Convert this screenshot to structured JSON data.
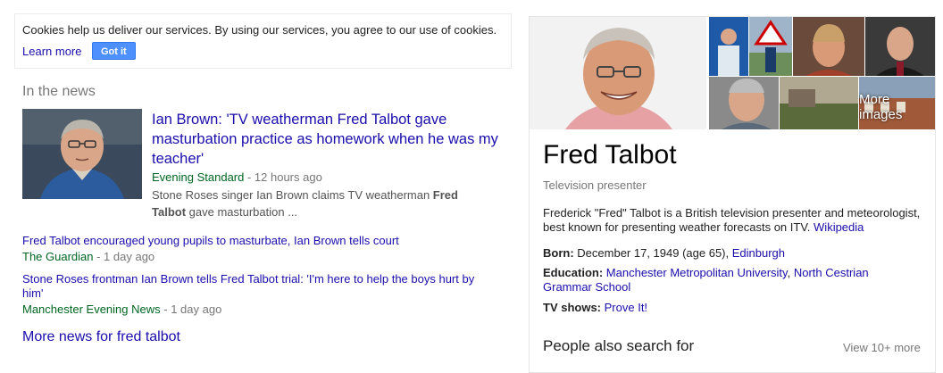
{
  "cookie_banner": {
    "text": "Cookies help us deliver our services. By using our services, you agree to our use of cookies.",
    "learn_more": "Learn more",
    "got_it": "Got it"
  },
  "news": {
    "heading": "In the news",
    "top_story": {
      "title": "Ian Brown: 'TV weatherman Fred Talbot gave masturbation practice as homework when he was my teacher'",
      "source": "Evening Standard",
      "time": " - 12 hours ago",
      "snippet_pre": "Stone Roses singer Ian Brown claims TV weatherman ",
      "snippet_bold1": "Fred",
      "snippet_bold2": "Talbot",
      "snippet_post": " gave masturbation ..."
    },
    "stories": [
      {
        "title": "Fred Talbot encouraged young pupils to masturbate, Ian Brown tells court",
        "source": "The Guardian",
        "time": " - 1 day ago"
      },
      {
        "title": "Stone Roses frontman Ian Brown tells Fred Talbot trial: 'I'm here to help the boys hurt by him'",
        "source": "Manchester Evening News",
        "time": " - 1 day ago"
      }
    ],
    "more_link": "More news for fred talbot"
  },
  "knowledge_panel": {
    "more_images": "More images",
    "title": "Fred Talbot",
    "subtitle": "Television presenter",
    "description": "Frederick \"Fred\" Talbot is a British television presenter and meteorologist, best known for presenting weather forecasts on ITV.",
    "wikipedia": "Wikipedia",
    "born_label": "Born:",
    "born_value": "December 17, 1949 (age 65),",
    "born_place": "Edinburgh",
    "education_label": "Education:",
    "education_1": "Manchester Metropolitan University",
    "education_sep": ",",
    "education_2": "North Cestrian Grammar School",
    "tv_label": "TV shows:",
    "tv_value": "Prove It!",
    "people_also_search": "People also search for",
    "view_more": "View 10+ more"
  },
  "colors": {
    "link": "#1a0dab",
    "source": "#006621",
    "meta": "#777777",
    "button": "#4d90fe"
  }
}
